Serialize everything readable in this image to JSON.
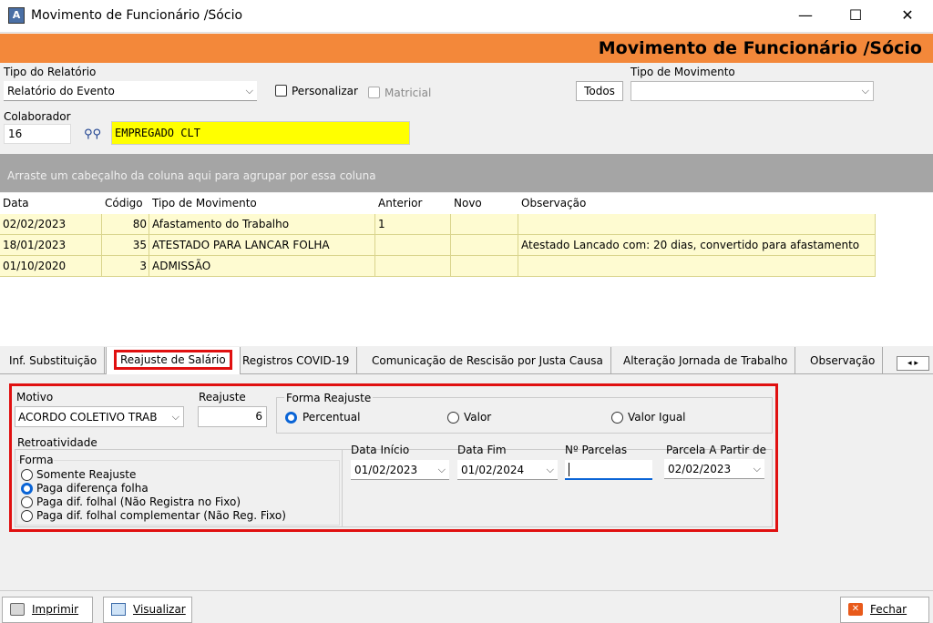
{
  "window": {
    "title": "Movimento de Funcionário /Sócio",
    "minimize": "—",
    "maximize": "☐",
    "close": "✕"
  },
  "header": {
    "title": "Movimento de Funcionário /Sócio"
  },
  "form": {
    "tipo_relatorio_label": "Tipo do Relatório",
    "tipo_relatorio_value": "Relatório do Evento",
    "personalizar_label": "Personalizar",
    "matricial_label": "Matricial",
    "todos_label": "Todos",
    "tipo_movimento_label": "Tipo de Movimento",
    "tipo_movimento_value": "",
    "colaborador_label": "Colaborador",
    "colaborador_value": "16",
    "colaborador_name": "EMPREGADO CLT"
  },
  "group_hint": "Arraste um cabeçalho da coluna aqui para agrupar por essa coluna",
  "grid": {
    "headers": [
      "Data",
      "Código",
      "Tipo de Movimento",
      "Anterior",
      "Novo",
      "Observação"
    ],
    "rows": [
      [
        "02/02/2023",
        "80",
        "Afastamento do Trabalho",
        "1",
        "",
        ""
      ],
      [
        "18/01/2023",
        "35",
        "ATESTADO PARA LANCAR FOLHA",
        "",
        "",
        "Atestado Lancado com: 20 dias, convertido para afastamento"
      ],
      [
        "01/10/2020",
        "3",
        "ADMISSÃO",
        "",
        "",
        ""
      ]
    ]
  },
  "tabs": [
    "Inf. Substituição",
    "Reajuste de Salário",
    "Registros COVID-19",
    "Comunicação de Rescisão por Justa Causa",
    "Alteração Jornada de Trabalho",
    "Observação"
  ],
  "active_tab": "Reajuste de Salário",
  "reajuste": {
    "motivo_label": "Motivo",
    "motivo_value": "ACORDO COLETIVO TRAB",
    "reajuste_label": "Reajuste",
    "reajuste_value": "6",
    "forma_reajuste_label": "Forma Reajuste",
    "forma_options": [
      "Percentual",
      "Valor",
      "Valor Igual"
    ],
    "retro_label": "Retroatividade",
    "forma_label": "Forma",
    "retro_options": [
      "Somente Reajuste",
      "Paga diferença folha",
      "Paga dif. folhal (Não Registra no Fixo)",
      "Paga dif. folhal complementar (Não Reg. Fixo)"
    ],
    "data_inicio_label": "Data Início",
    "data_inicio_value": "01/02/2023",
    "data_fim_label": "Data Fim",
    "data_fim_value": "01/02/2024",
    "parcelas_label": "Nº Parcelas",
    "parcelas_value": "",
    "parcela_partir_label": "Parcela A Partir de",
    "parcela_partir_value": "02/02/2023"
  },
  "footer": {
    "imprimir": "Imprimir",
    "visualizar": "Visualizar",
    "fechar": "Fechar"
  },
  "colors": {
    "accent": "#f3883a",
    "highlight": "#ffff00",
    "grid_row": "#fefbd1",
    "red_frame": "#e01010"
  }
}
